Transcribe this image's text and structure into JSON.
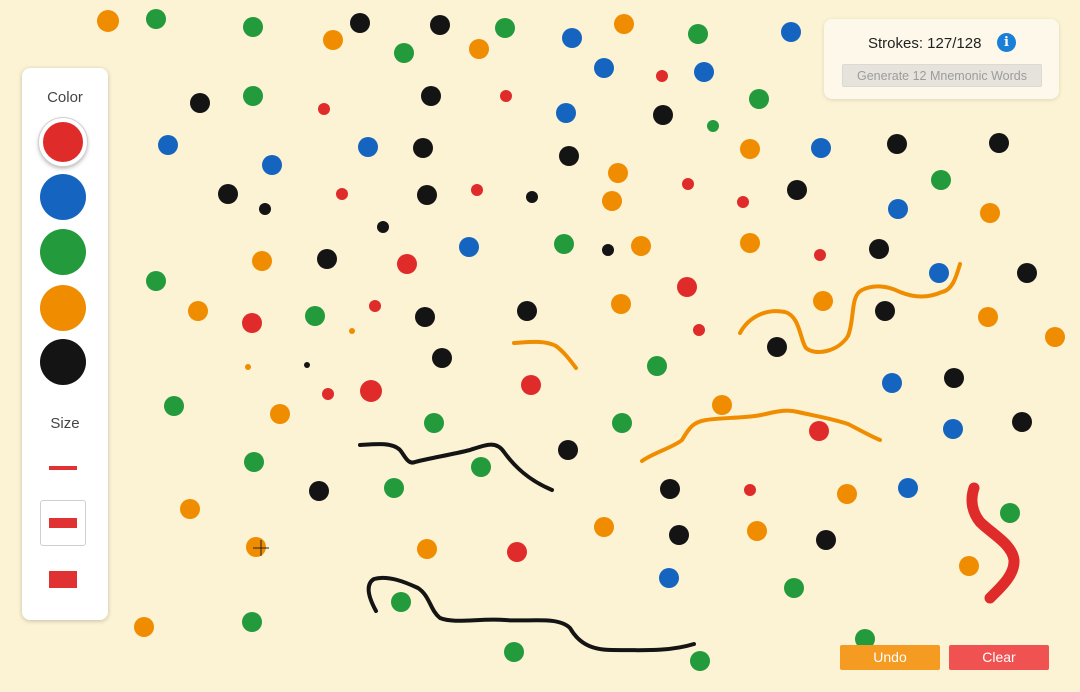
{
  "palette": {
    "color_heading": "Color",
    "size_heading": "Size",
    "colors": [
      {
        "name": "red",
        "hex": "#e02b2b",
        "selected": true
      },
      {
        "name": "blue",
        "hex": "#1565c0",
        "selected": false
      },
      {
        "name": "green",
        "hex": "#239a3b",
        "selected": false
      },
      {
        "name": "orange",
        "hex": "#f08c00",
        "selected": false
      },
      {
        "name": "black",
        "hex": "#141414",
        "selected": false
      }
    ],
    "sizes": [
      {
        "name": "small",
        "selected": false
      },
      {
        "name": "medium",
        "selected": true
      },
      {
        "name": "large",
        "selected": false
      }
    ]
  },
  "status": {
    "strokes_label": "Strokes: 127/128",
    "info_icon": "info-icon",
    "generate_label": "Generate 12 Mnemonic Words"
  },
  "actions": {
    "undo_label": "Undo",
    "clear_label": "Clear"
  },
  "colors": {
    "background": "#fcf3d4",
    "accent_undo": "#f59b22",
    "accent_clear": "#f05252"
  }
}
